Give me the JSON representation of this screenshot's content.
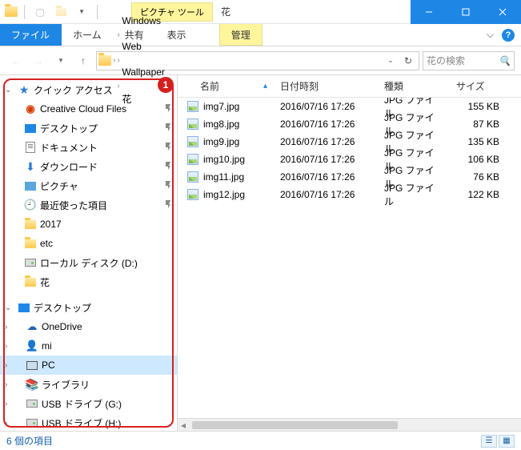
{
  "titlebar": {
    "tool_tab": "ピクチャ ツール",
    "title": "花"
  },
  "ribbon": {
    "file": "ファイル",
    "home": "ホーム",
    "share": "共有",
    "view": "表示",
    "manage": "管理"
  },
  "breadcrumbs": [
    "Windows",
    "Web",
    "Wallpaper",
    "花"
  ],
  "search_placeholder": "花の検索",
  "annotation": "1",
  "nav": {
    "quick_access": "クイック アクセス",
    "items_qa": [
      {
        "icon": "cc",
        "label": "Creative Cloud Files",
        "pin": true
      },
      {
        "icon": "desk",
        "label": "デスクトップ",
        "pin": true
      },
      {
        "icon": "doc",
        "label": "ドキュメント",
        "pin": true
      },
      {
        "icon": "down",
        "label": "ダウンロード",
        "pin": true
      },
      {
        "icon": "pic",
        "label": "ピクチャ",
        "pin": true
      },
      {
        "icon": "recent",
        "label": "最近使った項目",
        "pin": true
      },
      {
        "icon": "folder",
        "label": "2017",
        "pin": false
      },
      {
        "icon": "folder",
        "label": "etc",
        "pin": false
      },
      {
        "icon": "drive",
        "label": "ローカル ディスク (D:)",
        "pin": false
      },
      {
        "icon": "folder",
        "label": "花",
        "pin": false
      }
    ],
    "desktop": "デスクトップ",
    "items_dt": [
      {
        "icon": "cloud",
        "label": "OneDrive",
        "expand": ">"
      },
      {
        "icon": "user",
        "label": "mi",
        "expand": ">"
      },
      {
        "icon": "pc",
        "label": "PC",
        "expand": ">",
        "selected": true
      },
      {
        "icon": "lib",
        "label": "ライブラリ",
        "expand": ">"
      },
      {
        "icon": "drive",
        "label": "USB ドライブ (G:)",
        "expand": ">"
      },
      {
        "icon": "drive",
        "label": "USB ドライブ (H:)",
        "expand": ">"
      }
    ]
  },
  "columns": {
    "name": "名前",
    "date": "日付時刻",
    "type": "種類",
    "size": "サイズ"
  },
  "files": [
    {
      "name": "img7.jpg",
      "date": "2016/07/16 17:26",
      "type": "JPG ファイル",
      "size": "155 KB"
    },
    {
      "name": "img8.jpg",
      "date": "2016/07/16 17:26",
      "type": "JPG ファイル",
      "size": "87 KB"
    },
    {
      "name": "img9.jpg",
      "date": "2016/07/16 17:26",
      "type": "JPG ファイル",
      "size": "135 KB"
    },
    {
      "name": "img10.jpg",
      "date": "2016/07/16 17:26",
      "type": "JPG ファイル",
      "size": "106 KB"
    },
    {
      "name": "img11.jpg",
      "date": "2016/07/16 17:26",
      "type": "JPG ファイル",
      "size": "76 KB"
    },
    {
      "name": "img12.jpg",
      "date": "2016/07/16 17:26",
      "type": "JPG ファイル",
      "size": "122 KB"
    }
  ],
  "status": "6 個の項目"
}
